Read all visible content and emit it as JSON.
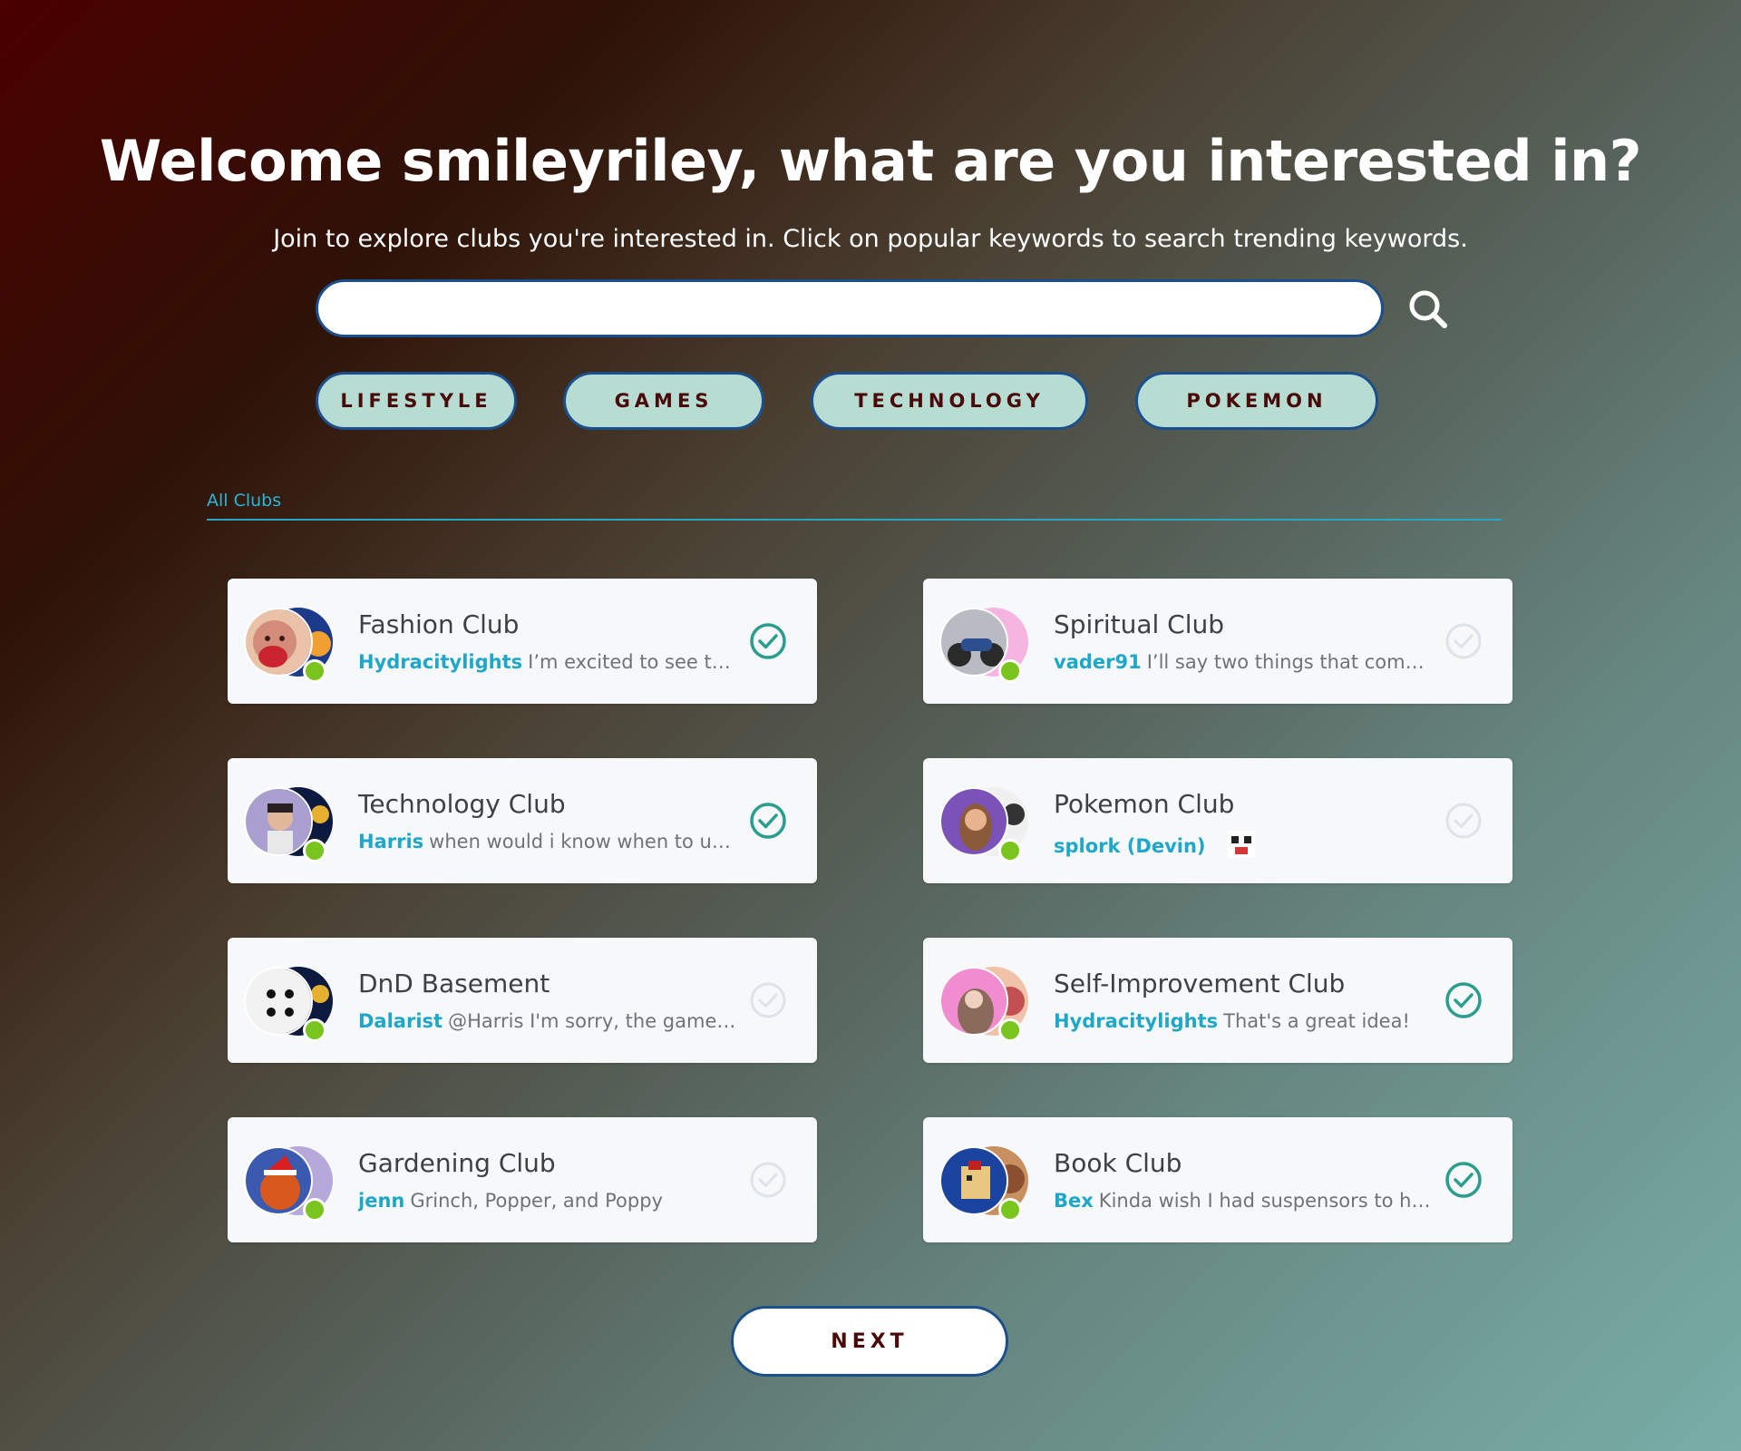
{
  "header": {
    "title": "Welcome smileyriley, what are you interested in?",
    "subtitle": "Join to explore clubs you're interested in. Click on popular keywords to search trending keywords."
  },
  "search": {
    "value": "",
    "placeholder": ""
  },
  "keywords": [
    {
      "label": "LIFESTYLE"
    },
    {
      "label": "GAMES"
    },
    {
      "label": "TECHNOLOGY"
    },
    {
      "label": "POKEMON"
    }
  ],
  "tab": {
    "label": "All Clubs"
  },
  "clubs": [
    {
      "name": "Fashion Club",
      "user": "Hydracitylights",
      "message": "I’m excited to see the f...",
      "joined": true
    },
    {
      "name": "Spiritual Club",
      "user": "vader91",
      "message": "I’ll say two things that comes...",
      "joined": false
    },
    {
      "name": "Technology Club",
      "user": "Harris",
      "message": "when would i know when to up...",
      "joined": true
    },
    {
      "name": "Pokemon Club",
      "user": "splork (Devin)",
      "message": "",
      "joined": false
    },
    {
      "name": "DnD Basement",
      "user": "Dalarist",
      "message": "@Harris I'm sorry, the game I...",
      "joined": false
    },
    {
      "name": "Self-Improvement Club",
      "user": "Hydracitylights",
      "message": "That's a great idea!",
      "joined": true
    },
    {
      "name": "Gardening Club",
      "user": "jenn",
      "message": "Grinch, Popper, and Poppy",
      "joined": false
    },
    {
      "name": "Book Club",
      "user": "Bex",
      "message": "Kinda wish I had suspensors to ho...",
      "joined": true
    }
  ],
  "next_label": "NEXT",
  "colors": {
    "accent_user": "#1ea7c8",
    "check_joined": "#2a9d8f",
    "check_unjoined": "#dde3e8",
    "pill_bg": "#b7ddd2",
    "pill_border": "#1b4e8c",
    "pill_text": "#4a0a0a",
    "online": "#7ac41e"
  }
}
